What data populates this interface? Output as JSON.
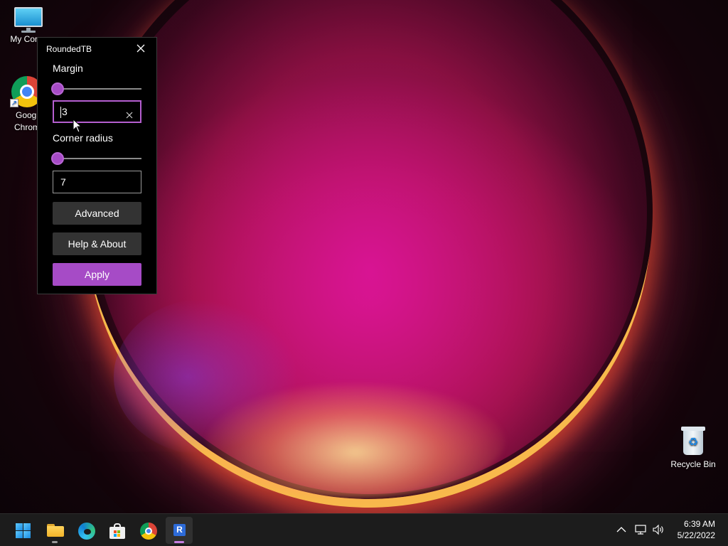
{
  "desktop": {
    "icons": [
      {
        "label": "My Comp"
      },
      {
        "label_line1": "Googl",
        "label_line2": "Chrom"
      },
      {
        "label": "Recycle Bin"
      }
    ]
  },
  "window": {
    "title": "RoundedTB",
    "margin": {
      "label": "Margin",
      "slider_value": 3,
      "input_value": "3"
    },
    "corner_radius": {
      "label": "Corner radius",
      "slider_value": 7,
      "input_value": "7"
    },
    "buttons": {
      "advanced": "Advanced",
      "help_about": "Help & About",
      "apply": "Apply"
    },
    "accent_color": "#a64bc6"
  },
  "taskbar": {
    "apps": [
      {
        "name": "start-icon",
        "active": false
      },
      {
        "name": "file-explorer-icon",
        "active": false,
        "running": true
      },
      {
        "name": "edge-icon",
        "active": false
      },
      {
        "name": "store-icon",
        "active": false
      },
      {
        "name": "chrome-icon",
        "active": false
      },
      {
        "name": "roundedtb-icon",
        "active": true,
        "running": true
      }
    ],
    "tray": {
      "icons": [
        "chevron-up-icon",
        "network-icon",
        "volume-icon"
      ]
    },
    "clock": {
      "time": "6:39 AM",
      "date": "5/22/2022"
    }
  }
}
